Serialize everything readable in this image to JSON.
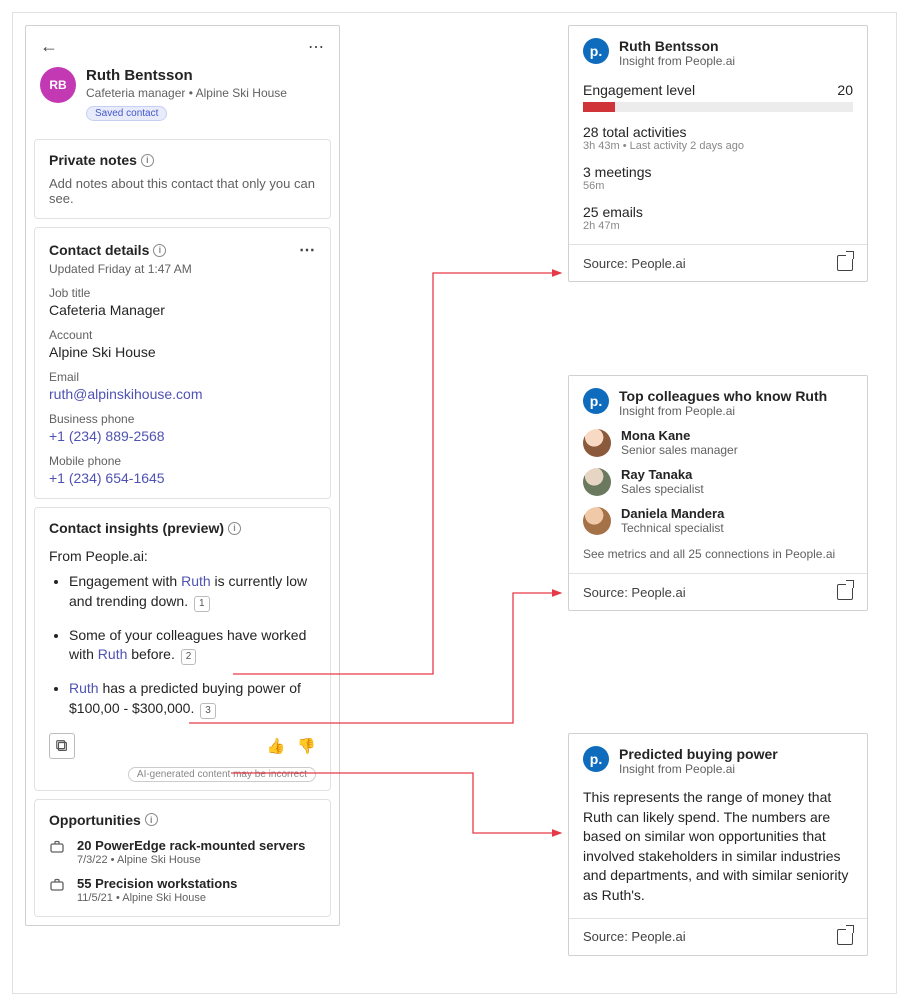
{
  "contact": {
    "initials": "RB",
    "name": "Ruth Bentsson",
    "subtitle": "Cafeteria manager • Alpine Ski House",
    "badge": "Saved contact"
  },
  "notes": {
    "title": "Private notes",
    "placeholder": "Add notes about this contact that only you can see."
  },
  "details": {
    "title": "Contact details",
    "updated": "Updated Friday at 1:47 AM",
    "job_label": "Job title",
    "job_value": "Cafeteria Manager",
    "account_label": "Account",
    "account_value": "Alpine Ski House",
    "email_label": "Email",
    "email_value": "ruth@alpinskihouse.com",
    "bphone_label": "Business phone",
    "bphone_value": "+1 (234) 889-2568",
    "mphone_label": "Mobile phone",
    "mphone_value": "+1 (234) 654-1645"
  },
  "insights": {
    "title": "Contact insights (preview)",
    "from_label": "From People.ai:",
    "i1a": "Engagement with ",
    "i1b": "Ruth",
    "i1c": " is currently low and trending down.",
    "i2a": "Some of your colleagues have worked with ",
    "i2b": "Ruth",
    "i2c": " before.",
    "i3a": "Ruth",
    "i3b": " has a predicted buying power of $100,00 - $300,000.",
    "c1": "1",
    "c2": "2",
    "c3": "3",
    "ai_warn": "AI-generated content may be incorrect"
  },
  "opps": {
    "title": "Opportunities",
    "o1_title": "20 PowerEdge rack-mounted servers",
    "o1_sub": "7/3/22 • Alpine Ski House",
    "o2_title": "55 Precision workstations",
    "o2_sub": "11/5/21 • Alpine Ski House"
  },
  "engagement": {
    "name": "Ruth Bentsson",
    "sub": "Insight from People.ai",
    "level_label": "Engagement level",
    "level_value": "20",
    "fill_pct": "12%",
    "act_title": "28 total activities",
    "act_sub": "3h 43m • Last activity 2 days ago",
    "meet_title": "3 meetings",
    "meet_sub": "56m",
    "email_title": "25 emails",
    "email_sub": "2h 47m",
    "source": "Source: People.ai"
  },
  "colleagues": {
    "title": "Top colleagues who know Ruth",
    "sub": "Insight from People.ai",
    "c1_name": "Mona Kane",
    "c1_role": "Senior sales manager",
    "c2_name": "Ray Tanaka",
    "c2_role": "Sales specialist",
    "c3_name": "Daniela Mandera",
    "c3_role": "Technical specialist",
    "see_more": "See metrics and all 25 connections in People.ai",
    "source": "Source: People.ai"
  },
  "buying": {
    "title": "Predicted buying power",
    "sub": "Insight from People.ai",
    "desc": "This represents the range of money that Ruth can likely spend. The numbers are based on similar won opportunities that involved stakeholders in similar industries and departments, and with similar seniority as Ruth's.",
    "source": "Source: People.ai"
  }
}
